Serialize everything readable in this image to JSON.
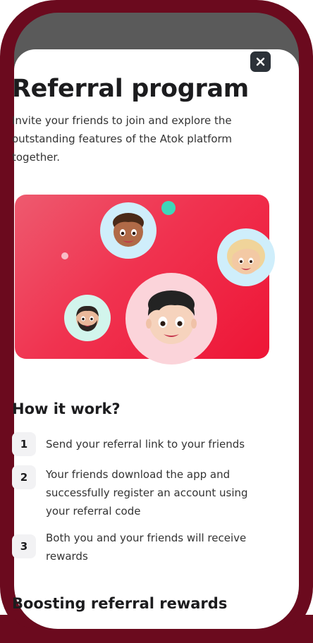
{
  "modal": {
    "title": "Referral program",
    "description": "Invite your friends to join and explore the outstanding features of the Atok platform together.",
    "close_icon": "close-icon"
  },
  "how_it_works": {
    "title": "How it work?",
    "steps": [
      {
        "num": "1",
        "text": "Send your referral link to your friends"
      },
      {
        "num": "2",
        "text": "Your friends download the app and successfully register an account using your referral code"
      },
      {
        "num": "3",
        "text": "Both you and your friends will receive rewards"
      }
    ]
  },
  "boosting": {
    "title": "Boosting referral rewards"
  },
  "colors": {
    "frame": "#6b0a1e",
    "banner_start": "#ee5a6f",
    "banner_end": "#ee1536",
    "accent_teal": "#3fd6b9",
    "text_dark": "#1c1c1e"
  }
}
